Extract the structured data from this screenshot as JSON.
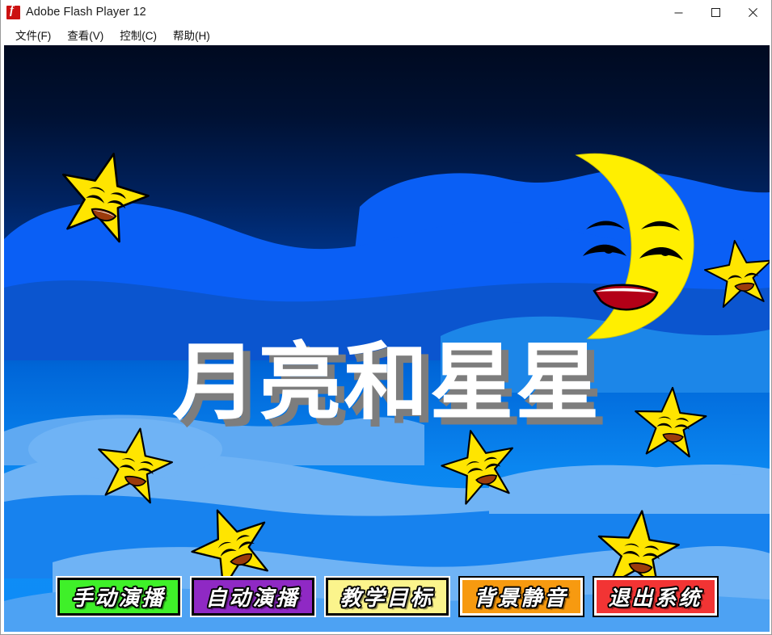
{
  "window": {
    "title": "Adobe Flash Player 12",
    "icon": "flash-logo-icon",
    "controls": {
      "minimize": "minimize-icon",
      "maximize": "maximize-icon",
      "close": "close-icon"
    }
  },
  "menubar": {
    "items": [
      {
        "label": "文件(F)"
      },
      {
        "label": "查看(V)"
      },
      {
        "label": "控制(C)"
      },
      {
        "label": "帮助(H)"
      }
    ]
  },
  "stage": {
    "title": "月亮和星星",
    "title_color": "#ffffff",
    "title_shadow_color": "#7d7d7d",
    "sky_top_color": "#000a20",
    "sky_bottom_color": "#0d8cf8",
    "moon": {
      "name": "smiling-crescent-moon",
      "fill": "#ffef00"
    },
    "stars": [
      {
        "name": "smiling-star-top-left",
        "fill": "#ffe500"
      },
      {
        "name": "smiling-star-right-upper",
        "fill": "#ffe500"
      },
      {
        "name": "smiling-star-left-middle",
        "fill": "#ffe500"
      },
      {
        "name": "smiling-star-center",
        "fill": "#ffe500"
      },
      {
        "name": "smiling-star-right-middle",
        "fill": "#ffe500"
      },
      {
        "name": "smiling-star-bottom-left",
        "fill": "#ffe500"
      },
      {
        "name": "smiling-star-bottom-right",
        "fill": "#ffe500"
      }
    ]
  },
  "buttons": [
    {
      "label": "手动演播",
      "bg": "#3ff029",
      "border": "#000000",
      "name": "manual-play-button"
    },
    {
      "label": "自动演播",
      "bg": "#8f29c4",
      "border": "#000000",
      "name": "auto-play-button"
    },
    {
      "label": "教学目标",
      "bg": "#fbf48c",
      "border": "#000000",
      "name": "teaching-goal-button"
    },
    {
      "label": "背景静音",
      "bg": "#f79a10",
      "border": "#ffffff",
      "name": "mute-background-button"
    },
    {
      "label": "退出系统",
      "bg": "#f23434",
      "border": "#ffffff",
      "name": "exit-system-button"
    }
  ]
}
